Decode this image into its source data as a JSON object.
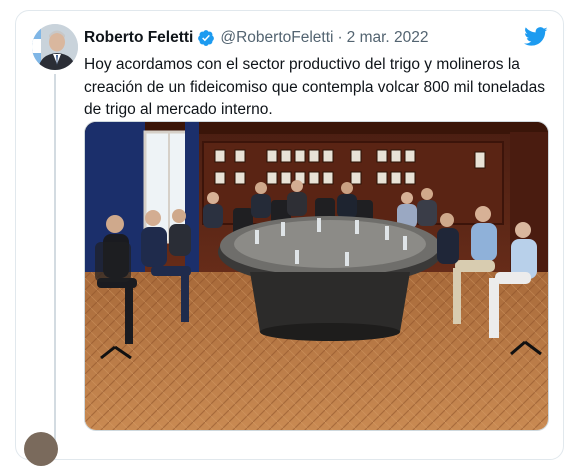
{
  "tweet": {
    "author_name": "Roberto Feletti",
    "handle": "@RobertoFeletti",
    "separator": "·",
    "date": "2 mar. 2022",
    "text": "Hoy acordamos con el sector productivo del trigo y molineros la creación de un fideicomiso que contempla volcar 800 mil toneladas de trigo al mercado interno."
  },
  "icons": {
    "verified": "verified-badge-icon",
    "brand": "twitter-bird-icon"
  },
  "colors": {
    "brand": "#1d9bf0",
    "name": "#0f1419",
    "secondary": "#536471",
    "border": "#e1e8ed"
  }
}
